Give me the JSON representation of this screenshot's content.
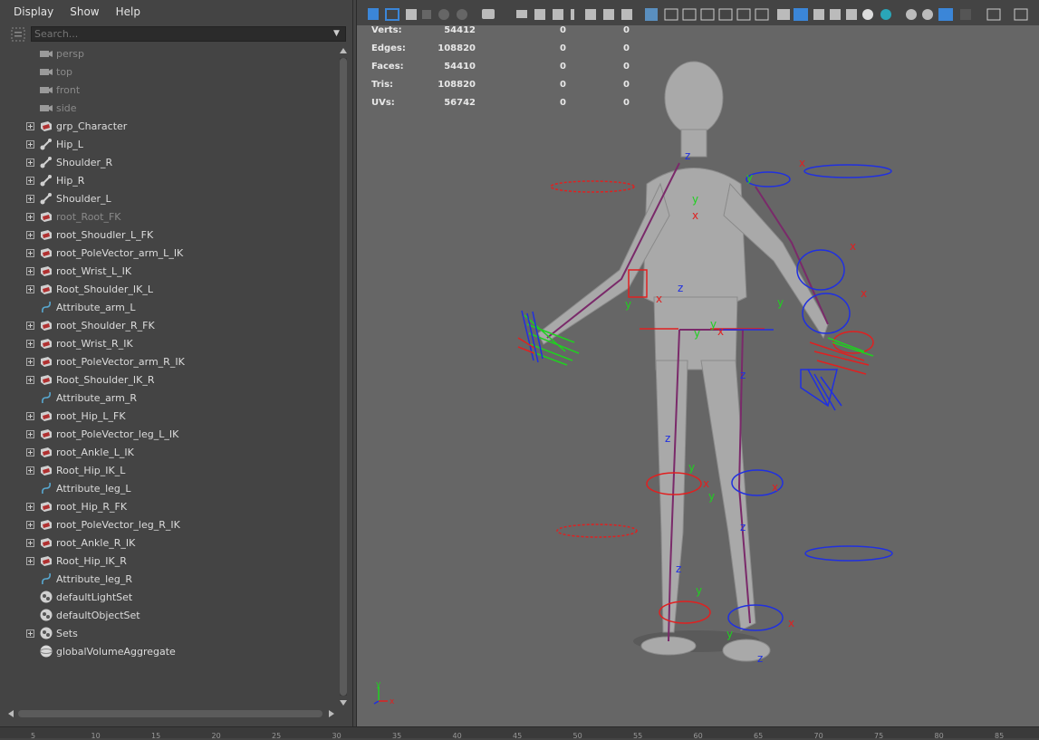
{
  "outliner": {
    "menu": [
      "Display",
      "Show",
      "Help"
    ],
    "search_placeholder": "Search...",
    "items": [
      {
        "label": "persp",
        "icon": "camera",
        "expandable": false,
        "dim": true
      },
      {
        "label": "top",
        "icon": "camera",
        "expandable": false,
        "dim": true
      },
      {
        "label": "front",
        "icon": "camera",
        "expandable": false,
        "dim": true
      },
      {
        "label": "side",
        "icon": "camera",
        "expandable": false,
        "dim": true
      },
      {
        "label": "grp_Character",
        "icon": "group",
        "expandable": true,
        "dim": false
      },
      {
        "label": "Hip_L",
        "icon": "joint",
        "expandable": true,
        "dim": false
      },
      {
        "label": "Shoulder_R",
        "icon": "joint",
        "expandable": true,
        "dim": false
      },
      {
        "label": "Hip_R",
        "icon": "joint",
        "expandable": true,
        "dim": false
      },
      {
        "label": "Shoulder_L",
        "icon": "joint",
        "expandable": true,
        "dim": false
      },
      {
        "label": "root_Root_FK",
        "icon": "group",
        "expandable": true,
        "dim": true
      },
      {
        "label": "root_Shoudler_L_FK",
        "icon": "group",
        "expandable": true,
        "dim": false
      },
      {
        "label": "root_PoleVector_arm_L_IK",
        "icon": "group",
        "expandable": true,
        "dim": false
      },
      {
        "label": "root_Wrist_L_IK",
        "icon": "group",
        "expandable": true,
        "dim": false
      },
      {
        "label": "Root_Shoulder_IK_L",
        "icon": "group",
        "expandable": true,
        "dim": false
      },
      {
        "label": "Attribute_arm_L",
        "icon": "curve",
        "expandable": false,
        "dim": false
      },
      {
        "label": "root_Shoulder_R_FK",
        "icon": "group",
        "expandable": true,
        "dim": false
      },
      {
        "label": "root_Wrist_R_IK",
        "icon": "group",
        "expandable": true,
        "dim": false
      },
      {
        "label": "root_PoleVector_arm_R_IK",
        "icon": "group",
        "expandable": true,
        "dim": false
      },
      {
        "label": "Root_Shoulder_IK_R",
        "icon": "group",
        "expandable": true,
        "dim": false
      },
      {
        "label": "Attribute_arm_R",
        "icon": "curve",
        "expandable": false,
        "dim": false
      },
      {
        "label": "root_Hip_L_FK",
        "icon": "group",
        "expandable": true,
        "dim": false
      },
      {
        "label": "root_PoleVector_leg_L_IK",
        "icon": "group",
        "expandable": true,
        "dim": false
      },
      {
        "label": "root_Ankle_L_IK",
        "icon": "group",
        "expandable": true,
        "dim": false
      },
      {
        "label": "Root_Hip_IK_L",
        "icon": "group",
        "expandable": true,
        "dim": false
      },
      {
        "label": "Attribute_leg_L",
        "icon": "curve",
        "expandable": false,
        "dim": false
      },
      {
        "label": "root_Hip_R_FK",
        "icon": "group",
        "expandable": true,
        "dim": false
      },
      {
        "label": "root_PoleVector_leg_R_IK",
        "icon": "group",
        "expandable": true,
        "dim": false
      },
      {
        "label": "root_Ankle_R_IK",
        "icon": "group",
        "expandable": true,
        "dim": false
      },
      {
        "label": "Root_Hip_IK_R",
        "icon": "group",
        "expandable": true,
        "dim": false
      },
      {
        "label": "Attribute_leg_R",
        "icon": "curve",
        "expandable": false,
        "dim": false
      },
      {
        "label": "defaultLightSet",
        "icon": "set",
        "expandable": false,
        "dim": false
      },
      {
        "label": "defaultObjectSet",
        "icon": "set",
        "expandable": false,
        "dim": false
      },
      {
        "label": "Sets",
        "icon": "set",
        "expandable": true,
        "dim": false
      },
      {
        "label": "globalVolumeAggregate",
        "icon": "volume",
        "expandable": false,
        "dim": false
      }
    ]
  },
  "viewport": {
    "hud": [
      {
        "label": "Verts:",
        "total": "54412",
        "selected": "0",
        "component": "0"
      },
      {
        "label": "Edges:",
        "total": "108820",
        "selected": "0",
        "component": "0"
      },
      {
        "label": "Faces:",
        "total": "54410",
        "selected": "0",
        "component": "0"
      },
      {
        "label": "Tris:",
        "total": "108820",
        "selected": "0",
        "component": "0"
      },
      {
        "label": "UVs:",
        "total": "56742",
        "selected": "0",
        "component": "0"
      }
    ],
    "axis": {
      "x": "x",
      "y": "y"
    }
  },
  "timeline": {
    "ticks": [
      "5",
      "10",
      "15",
      "20",
      "25",
      "30",
      "35",
      "40",
      "45",
      "50",
      "55",
      "60",
      "65",
      "70",
      "75",
      "80",
      "85"
    ]
  },
  "colors": {
    "panel_bg": "#444444",
    "viewport_bg": "#666666",
    "control_red": "#e02020",
    "control_blue": "#2030e0",
    "axis_green": "#20d020"
  }
}
